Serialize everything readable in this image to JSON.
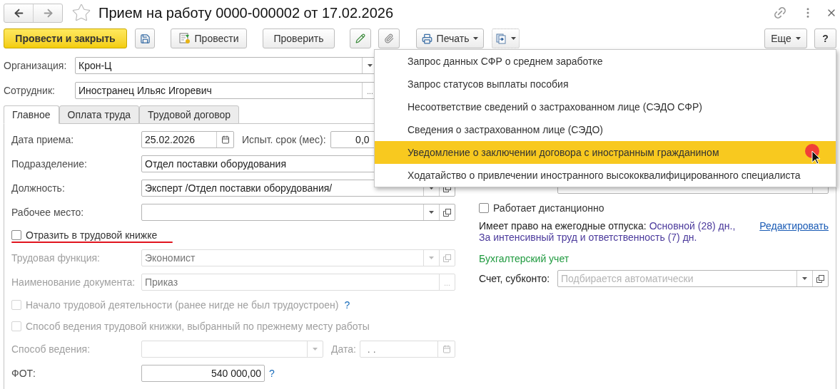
{
  "window": {
    "title": "Прием на работу 0000-000002 от 17.02.2026",
    "favorite": false
  },
  "toolbar": {
    "post_close": "Провести и закрыть",
    "post": "Провести",
    "check": "Проверить",
    "print": "Печать",
    "more": "Еще",
    "help": "?"
  },
  "header_fields": [
    {
      "kind": "dropdown",
      "label": "Организация:",
      "value": "Крон-Ц"
    },
    {
      "kind": "select",
      "label": "Сотрудник:",
      "value": "Иностранец Ильяс Игоревич",
      "button_text": "..."
    }
  ],
  "tabs": [
    {
      "label": "Главное",
      "selected": true
    },
    {
      "label": "Оплата труда",
      "selected": false
    },
    {
      "label": "Трудовой договор",
      "selected": false
    }
  ],
  "main_fields": [
    {
      "kind": "date",
      "label": "Дата приема:",
      "value": "25.02.2026",
      "extra_label": "Испыт. срок (мес):",
      "extra_value": "0,0",
      "disabled": false
    },
    {
      "kind": "text",
      "label": "Подразделение:",
      "value": "Отдел поставки оборудования",
      "disabled": false
    },
    {
      "kind": "combo",
      "label": "Должность:",
      "value": "Эксперт /Отдел поставки оборудования/",
      "disabled": false
    },
    {
      "kind": "combo",
      "label": "Рабочее место:",
      "disabled": false
    },
    {
      "kind": "checkbox",
      "label": "Отразить в трудовой книжке",
      "checked": false,
      "disabled": false,
      "highlighted": true
    },
    {
      "kind": "combo",
      "label": "Трудовая функция:",
      "value": "Экономист",
      "disabled": true
    },
    {
      "kind": "select",
      "label": "Наименование документа:",
      "value": "Приказ",
      "button_text": "...",
      "disabled": true
    },
    {
      "kind": "checkbox",
      "label": "Начало трудовой деятельности (ранее нигде не был трудоустроен)",
      "checked": false,
      "disabled": true,
      "help": "?"
    },
    {
      "kind": "checkbox",
      "label": "Способ ведения трудовой книжки, выбранный по прежнему месту работы",
      "checked": false,
      "disabled": true
    },
    {
      "kind": "combo_date",
      "label": "Способ ведения:",
      "extra_label": "Дата:",
      "extra_value": ". .",
      "disabled": true
    },
    {
      "kind": "number",
      "label": "ФОТ:",
      "value": "540 000,00",
      "help": "?",
      "disabled": false
    }
  ],
  "right": {
    "remote": {
      "label": "Работает дистанционно",
      "checked": false
    },
    "leave": {
      "label": "Имеет право на ежегодные отпуска:",
      "items": [
        "Основной (28) дн.,",
        "За интенсивный труд и ответственность (7) дн."
      ],
      "edit_link": "Редактировать"
    },
    "accounting": {
      "heading": "Бухгалтерский учет",
      "label": "Счет, субконто:",
      "placeholder": "Подбирается автоматически"
    }
  },
  "menu": [
    {
      "label": "Запрос данных СФР о среднем заработке",
      "selected": false
    },
    {
      "label": "Запрос статусов выплаты пособия",
      "selected": false
    },
    {
      "label": "Несоответствие сведений о застрахованном лице (СЭДО СФР)",
      "selected": false
    },
    {
      "label": "Сведения о застрахованном лице (СЭДО)",
      "selected": false
    },
    {
      "label": "Уведомление о заключении договора с иностранным гражданином",
      "selected": true
    },
    {
      "label": "Ходатайство о привлечении иностранного высококвалифицированного специалиста",
      "selected": false
    }
  ]
}
